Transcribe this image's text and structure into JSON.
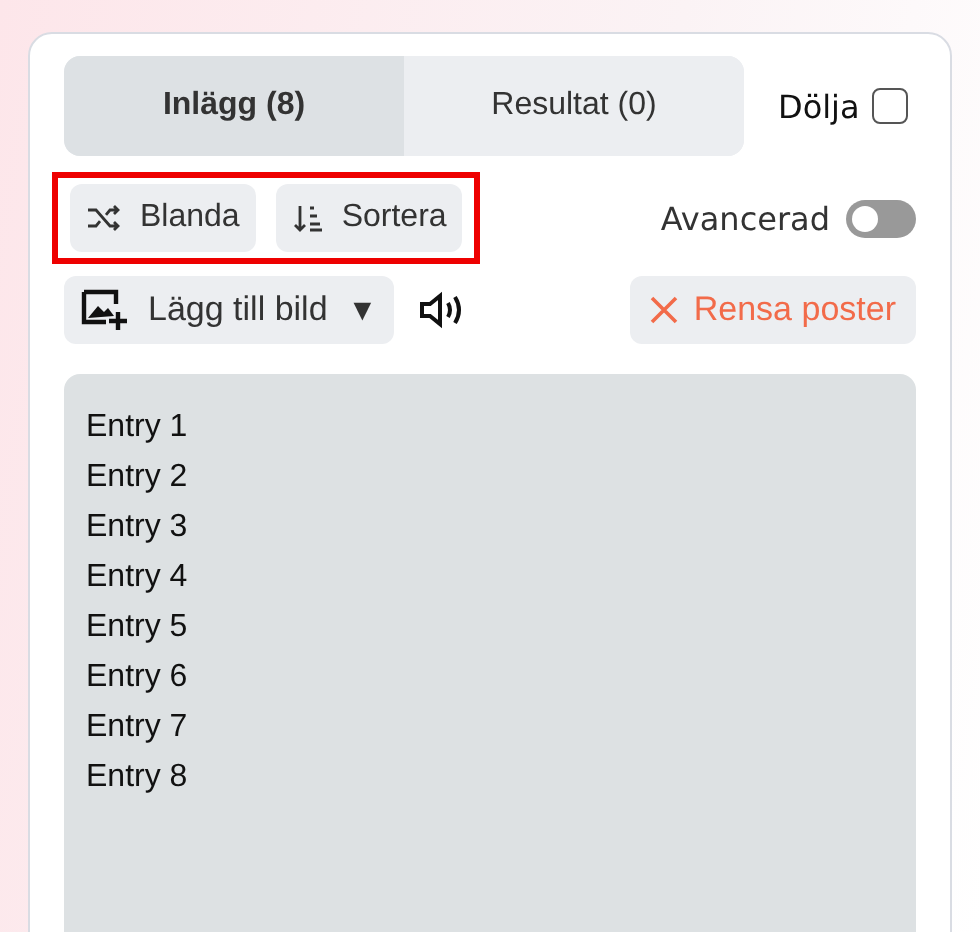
{
  "tabs": [
    {
      "label": "Inlägg (8)",
      "selected": true
    },
    {
      "label": "Resultat (0)",
      "selected": false
    }
  ],
  "hide": {
    "label": "Dölja",
    "checked": false
  },
  "actions": [
    {
      "kind": "shuffle",
      "label": "Blanda"
    },
    {
      "kind": "sort",
      "label": "Sortera"
    }
  ],
  "actions_highlighted": true,
  "advanced": {
    "label": "Avancerad",
    "on": false
  },
  "add_image": {
    "label": "Lägg till bild",
    "caret": "▼"
  },
  "clear": {
    "label": "Rensa poster"
  },
  "entries": [
    "Entry 1",
    "Entry 2",
    "Entry 3",
    "Entry 4",
    "Entry 5",
    "Entry 6",
    "Entry 7",
    "Entry 8"
  ]
}
